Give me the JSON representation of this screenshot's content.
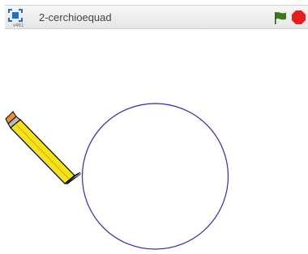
{
  "project": {
    "title": "2-cerchioequad",
    "version": "v461"
  },
  "controls": {
    "fullscreen_icon": "fullscreen-icon",
    "green_flag_icon": "green-flag-icon",
    "stop_icon": "stop-icon"
  },
  "colors": {
    "fullscreen": "#1a6fd6",
    "flag": "#3b7a1a",
    "stop": "#e81c1c",
    "pen_stroke": "#2a2ad6",
    "pencil_body": "#f5e21a"
  },
  "stage": {
    "sprite": "pencil-sprite",
    "drawing": "circle-drawing"
  }
}
